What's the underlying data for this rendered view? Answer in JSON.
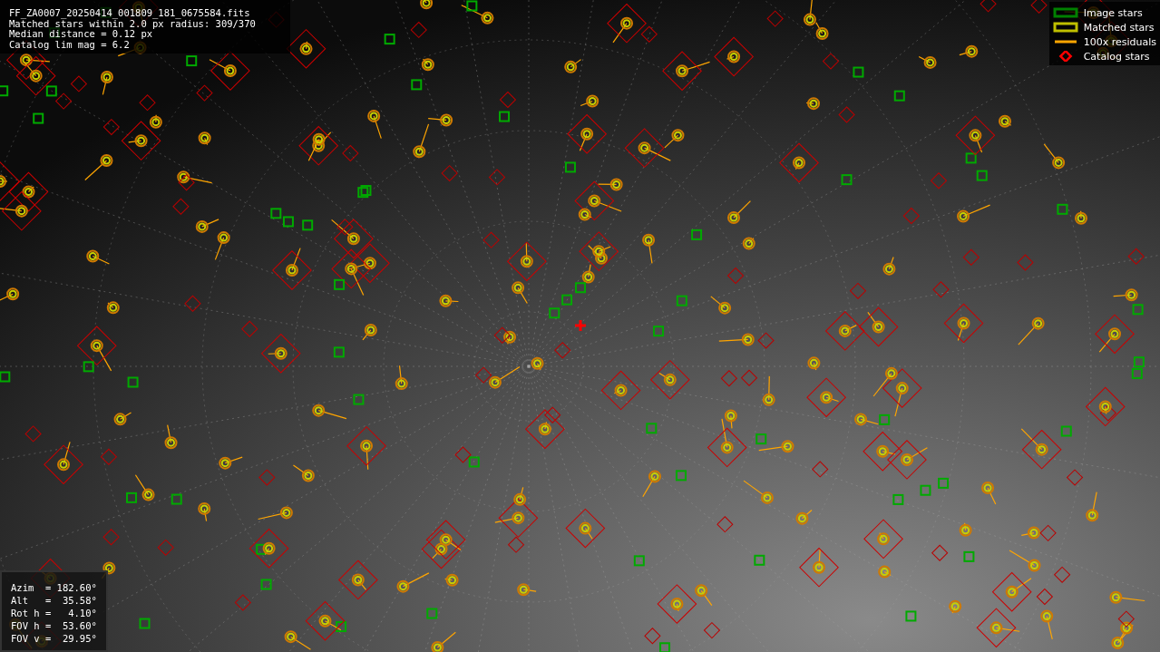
{
  "header": {
    "lines": [
      "FF_ZA0007_20250414_001809_181_0675584.fits",
      "Matched stars within 2.0 px radius: 309/370",
      "Median distance = 0.12 px",
      "Catalog lim mag = 6.2"
    ]
  },
  "legend": [
    {
      "label": "Image stars",
      "kind": "box",
      "color": "#008000"
    },
    {
      "label": "Matched stars",
      "kind": "box",
      "color": "#bfbf00"
    },
    {
      "label": "100x residuals",
      "kind": "line",
      "color": "#ffa500"
    },
    {
      "label": "Catalog stars",
      "kind": "diamond",
      "color": "#ff0000"
    }
  ],
  "pointing": {
    "lines": [
      "Azim  = 182.60°",
      "Alt   =  35.58°",
      "Rot h =   4.10°",
      "FOV h =  53.60°",
      "FOV v =  29.95°"
    ]
  }
}
